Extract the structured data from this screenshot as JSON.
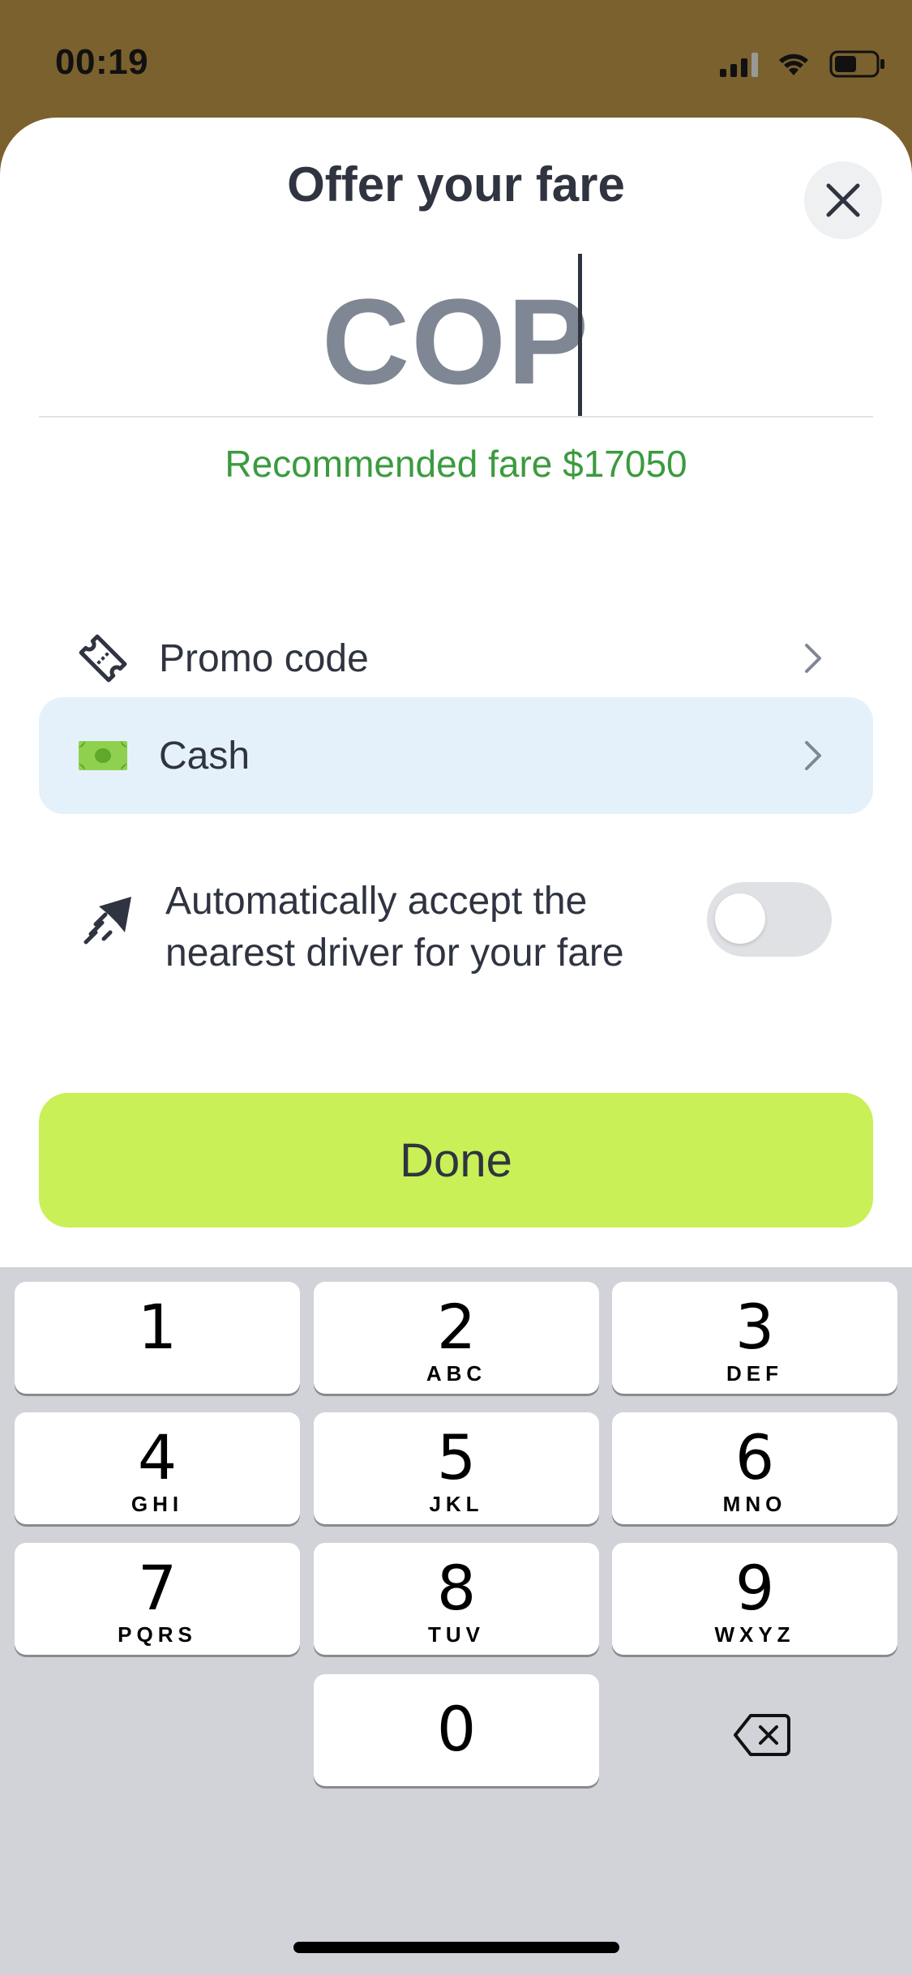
{
  "status_bar": {
    "time": "00:19"
  },
  "sheet": {
    "title": "Offer your fare",
    "fare_value": "COP",
    "recommended": "Recommended fare $17050",
    "promo": {
      "label": "Promo code",
      "icon": "ticket-icon"
    },
    "payment": {
      "label": "Cash",
      "icon": "cash-icon"
    },
    "auto_accept": {
      "text": "Automatically accept the nearest driver for your fare",
      "icon": "send-fast-icon",
      "enabled": false
    },
    "done_label": "Done"
  },
  "keyboard": {
    "keys": [
      {
        "num": "1",
        "letters": ""
      },
      {
        "num": "2",
        "letters": "ABC"
      },
      {
        "num": "3",
        "letters": "DEF"
      },
      {
        "num": "4",
        "letters": "GHI"
      },
      {
        "num": "5",
        "letters": "JKL"
      },
      {
        "num": "6",
        "letters": "MNO"
      },
      {
        "num": "7",
        "letters": "PQRS"
      },
      {
        "num": "8",
        "letters": "TUV"
      },
      {
        "num": "9",
        "letters": "WXYZ"
      },
      {
        "num": "0",
        "letters": ""
      }
    ]
  },
  "colors": {
    "accent_green": "#c9f056",
    "recommended_text": "#3b9b3f",
    "cash_bg": "#e4f1fb",
    "backdrop": "#7b612e"
  }
}
